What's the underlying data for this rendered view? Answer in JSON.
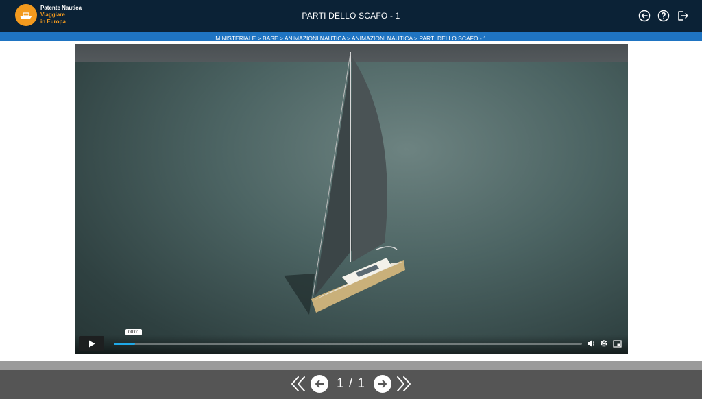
{
  "header": {
    "logo": {
      "line1": "Patente Nautica",
      "line2": "Viaggiare",
      "line3": "in Europa"
    },
    "title": "PARTI DELLO SCAFO - 1",
    "icons": [
      "back-circle-icon",
      "help-icon",
      "logout-icon"
    ]
  },
  "breadcrumb": {
    "text": "MINISTERIALE  >  BASE  >  ANIMAZIONI NAUTICA  >  ANIMAZIONI NAUTICA  >  PARTI DELLO SCAFO - 1"
  },
  "video": {
    "current_time": "00:01",
    "progress": 0.045,
    "controls": [
      "play-icon",
      "volume-icon",
      "settings-icon",
      "pip-icon"
    ]
  },
  "pager": {
    "label": "1 / 1"
  },
  "colors": {
    "header_bg": "#0b2236",
    "accent_orange": "#f39a1e",
    "breadcrumb_bg": "#1f74c2",
    "progress": "#1fa9e8",
    "bottom_bg": "#555555"
  }
}
